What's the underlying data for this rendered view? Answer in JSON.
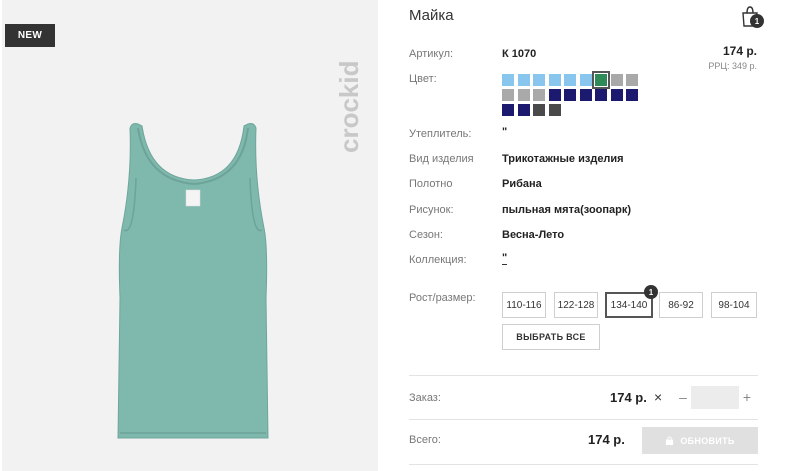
{
  "product": {
    "badge": "NEW",
    "brand": "crockid",
    "title": "Майка",
    "cart_count": "1"
  },
  "details": {
    "article_label": "Артикул:",
    "article_value": "К 1070",
    "price": "174 р.",
    "rrc": "РРЦ: 349 р.",
    "color_label": "Цвет:",
    "insulation_label": "Утеплитель:",
    "insulation_value": "\"",
    "type_label": "Вид изделия",
    "type_value": "Трикотажные изделия",
    "fabric_label": "Полотно",
    "fabric_value": "Рибана",
    "pattern_label": "Рисунок:",
    "pattern_value": "пыльная мята(зоопарк)",
    "season_label": "Сезон:",
    "season_value": "Весна-Лето",
    "collection_label": "Коллекция:",
    "collection_value": "\""
  },
  "swatches": [
    {
      "color": "#89c6ee"
    },
    {
      "color": "#89c6ee"
    },
    {
      "color": "#89c6ee"
    },
    {
      "color": "#89c6ee"
    },
    {
      "color": "#89c6ee"
    },
    {
      "color": "#89c6ee"
    },
    {
      "color": "#2e8b57",
      "selected": true
    },
    {
      "color": "#a9a9a9"
    },
    {
      "color": "#a9a9a9"
    },
    {
      "color": "#a9a9a9"
    },
    {
      "color": "#a9a9a9"
    },
    {
      "color": "#a9a9a9"
    },
    {
      "color": "#1c1a6e"
    },
    {
      "color": "#1c1a6e"
    },
    {
      "color": "#1c1a6e"
    },
    {
      "color": "#1c1a6e"
    },
    {
      "color": "#1c1a6e"
    },
    {
      "color": "#1c1a6e"
    },
    {
      "color": "#1c1a6e"
    },
    {
      "color": "#1c1a6e"
    },
    {
      "color": "#4a4a4a"
    },
    {
      "color": "#4a4a4a"
    }
  ],
  "sizes": {
    "label": "Рост/размер:",
    "options": [
      "110-116",
      "122-128",
      "134-140",
      "86-92",
      "98-104"
    ],
    "selected": "134-140",
    "selected_count": "1",
    "select_all": "ВЫБРАТЬ ВСЕ"
  },
  "order": {
    "label": "Заказ:",
    "price": "174 р.",
    "times": "×",
    "minus": "–",
    "plus": "+",
    "quantity": ""
  },
  "total": {
    "label": "Всего:",
    "price": "174 р.",
    "update_button": "ОБНОВИТЬ"
  },
  "colors": {
    "garment": "#7fb8ad",
    "badge_bg": "#333333",
    "button_disabled": "#e0e0e0"
  }
}
